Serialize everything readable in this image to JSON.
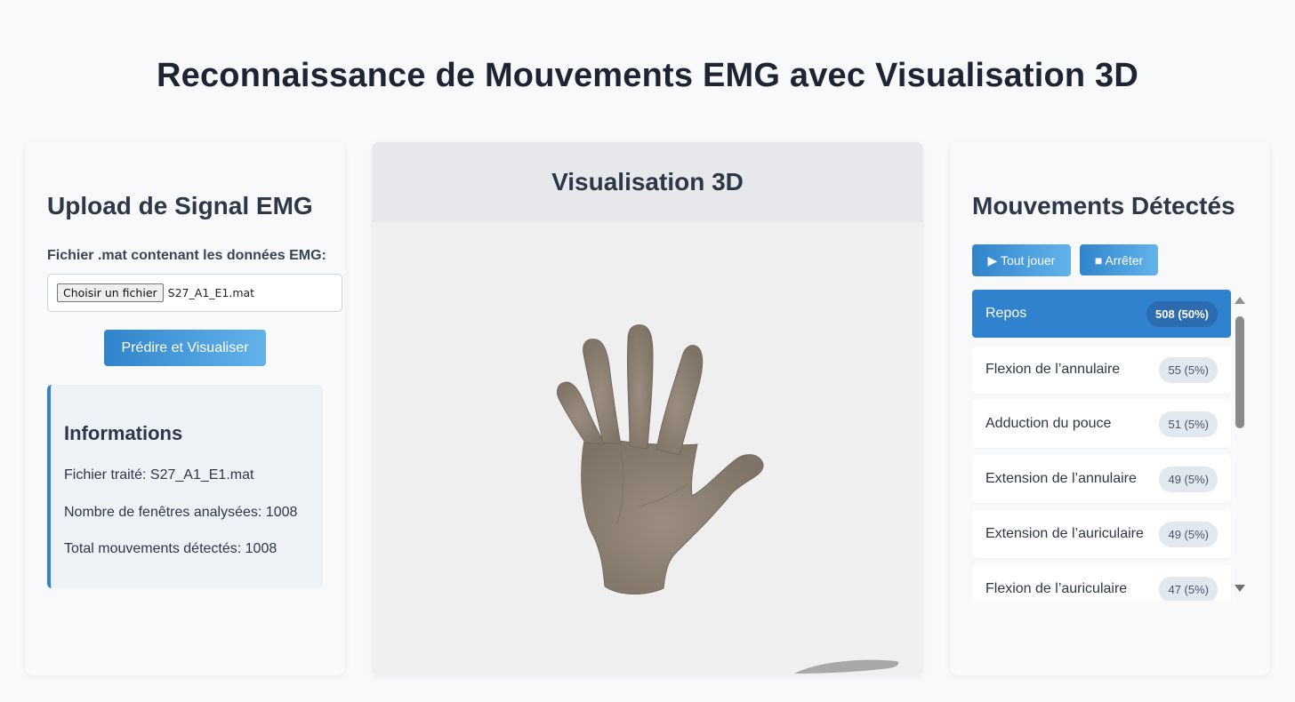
{
  "page": {
    "title": "Reconnaissance de Mouvements EMG avec Visualisation 3D"
  },
  "upload": {
    "heading": "Upload de Signal EMG",
    "file_label": "Fichier .mat contenant les données EMG:",
    "choose_button": "Choisir un fichier",
    "file_name": "S27_A1_E1.mat",
    "predict_button": "Prédire et Visualiser",
    "info": {
      "heading": "Informations",
      "processed_file": "Fichier traité: S27_A1_E1.mat",
      "windows_count": "Nombre de fenêtres analysées: 1008",
      "total_movements": "Total mouvements détectés: 1008"
    }
  },
  "viewer": {
    "title": "Visualisation 3D",
    "model": "hand-3d-model",
    "colors": {
      "hand": "#8e8276",
      "background": "#efeff0"
    }
  },
  "movements": {
    "heading": "Mouvements Détectés",
    "play_all_button": "▶ Tout jouer",
    "stop_button": "■ Arrêter",
    "items": [
      {
        "label": "Repos",
        "count": "508 (50%)"
      },
      {
        "label": "Flexion de l’annulaire",
        "count": "55 (5%)"
      },
      {
        "label": "Adduction du pouce",
        "count": "51 (5%)"
      },
      {
        "label": "Extension de l’annulaire",
        "count": "49 (5%)"
      },
      {
        "label": "Extension de l’auriculaire",
        "count": "49 (5%)"
      },
      {
        "label": "Flexion de l’auriculaire",
        "count": "47 (5%)"
      }
    ]
  },
  "colors": {
    "accent": "#3182ce",
    "accent_light": "#63b3ea",
    "badge_bg": "#e2e8f0"
  }
}
